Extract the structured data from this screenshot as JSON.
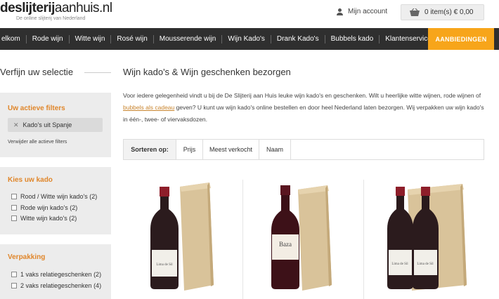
{
  "header": {
    "logo_bold": "deslijterij",
    "logo_rest": "aanhuis.nl",
    "tagline": "De online slijterij van Nederland",
    "account_label": "Mijn account",
    "cart_label": "0 item(s) € 0,00"
  },
  "nav": {
    "items": [
      "elkom",
      "Rode wijn",
      "Witte wijn",
      "Rosé wijn",
      "Mousserende wijn",
      "Wijn Kado's",
      "Drank Kado's",
      "Bubbels kado",
      "Klantenservice"
    ],
    "offer_label": "AANBIEDINGEN"
  },
  "sidebar": {
    "title": "Verfijn uw selectie",
    "active_filters": {
      "title": "Uw actieve filters",
      "chips": [
        "Kado's uit Spanje"
      ],
      "remove_all": "Verwijder alle actieve filters"
    },
    "kado": {
      "title": "Kies uw kado",
      "options": [
        "Rood / Witte wijn kado's (2)",
        "Rode wijn kado's (2)",
        "Witte wijn kado's (2)"
      ]
    },
    "verpakking": {
      "title": "Verpakking",
      "options": [
        "1 vaks relatiegeschenken (2)",
        "2 vaks relatiegeschenken (4)"
      ]
    }
  },
  "main": {
    "title": "Wijn kado's & Wijn geschenken bezorgen",
    "intro_before": "Voor iedere gelegenheid vindt u bij de De Slijterij aan Huis leuke wijn kado's en geschenken. Wilt u heerlijke witte wijnen, rode wijnen of ",
    "intro_link": "bubbels als cadeau",
    "intro_after": " geven? U kunt uw wijn kado's online bestellen en door heel Nederland laten bezorgen. Wij verpakken uw wijn kado's in één-, twee- of vierva​ksdozen.",
    "sort_label": "Sorteren op:",
    "sort_options": [
      "Prijs",
      "Meest verkocht",
      "Naam"
    ]
  },
  "products": [
    {
      "bottle_label": "Lima de Sil"
    },
    {
      "bottle_label": "Baza"
    },
    {
      "bottle_label": "Lima de Sil"
    }
  ],
  "colors": {
    "nav_bg": "#2f2f2f",
    "accent_orange": "#f7a51a",
    "panel_title": "#e0862a",
    "panel_bg": "#ececec"
  }
}
